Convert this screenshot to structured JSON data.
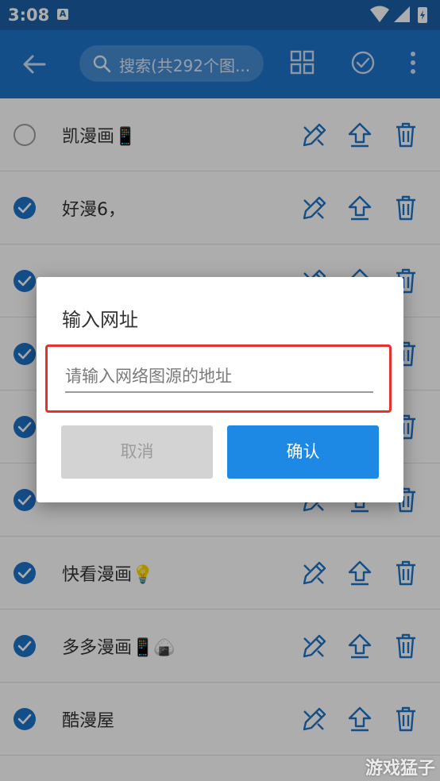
{
  "statusbar": {
    "time": "3:08",
    "notif_icon": "A"
  },
  "appbar": {
    "search_placeholder": "搜索(共292个图..."
  },
  "rows": [
    {
      "label": "凯漫画📱",
      "checked": false
    },
    {
      "label": "好漫6，",
      "checked": true
    },
    {
      "label": "",
      "checked": true
    },
    {
      "label": "",
      "checked": true
    },
    {
      "label": "",
      "checked": true
    },
    {
      "label": "",
      "checked": true
    },
    {
      "label": "快看漫画💡",
      "checked": true
    },
    {
      "label": "多多漫画📱🍙",
      "checked": true
    },
    {
      "label": "酷漫屋",
      "checked": true
    }
  ],
  "dialog": {
    "title": "输入网址",
    "input_placeholder": "请输入网络图源的地址",
    "input_value": "",
    "cancel_label": "取消",
    "ok_label": "确认"
  },
  "watermark": "游戏猛子",
  "colors": {
    "primary": "#1e73c9",
    "statusbar": "#1b5fa6",
    "accent": "#1e88e5",
    "highlight": "#e5322e"
  },
  "icons": [
    "back-arrow-icon",
    "search-icon",
    "grid-icon",
    "check-circle-icon",
    "more-vert-icon",
    "edit-icon",
    "upload-icon",
    "delete-icon"
  ]
}
